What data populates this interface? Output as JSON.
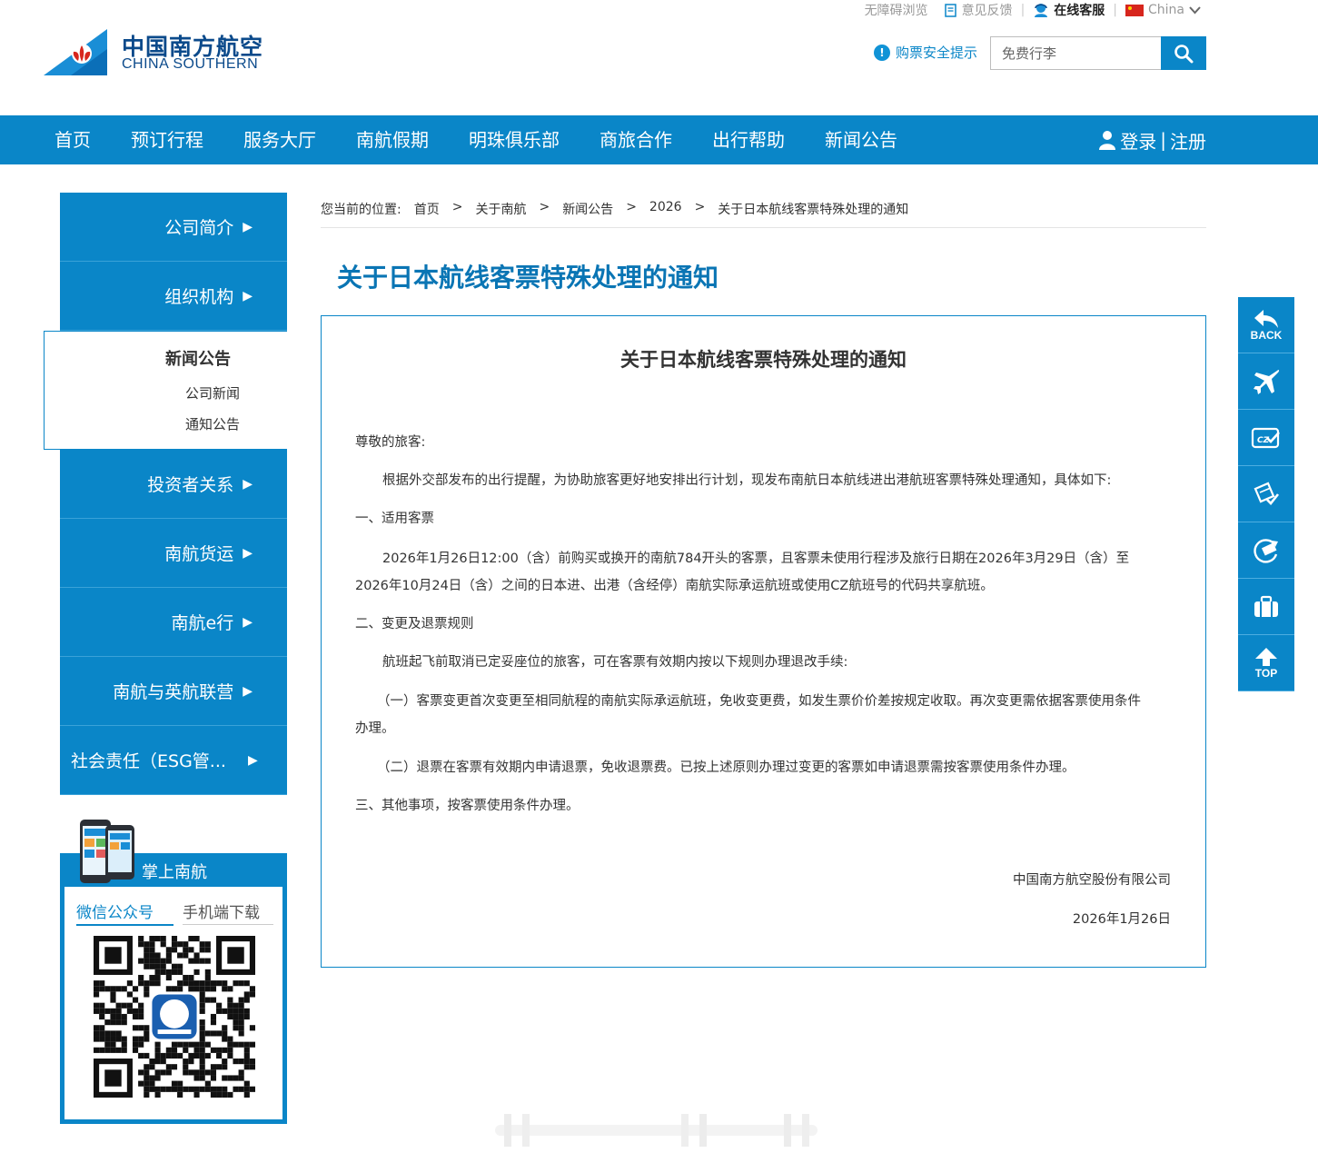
{
  "brand": {
    "name_cn": "中国南方航空",
    "name_en": "CHINA SOUTHERN",
    "accent_color": "#0a86c8",
    "title_color": "#0a75b4"
  },
  "top_links": {
    "accessibility": "无障碍浏览",
    "feedback": "意见反馈",
    "online_service": "在线客服",
    "region": "China"
  },
  "security_tip": "购票安全提示",
  "search": {
    "placeholder": "免费行李",
    "icon": "search-icon"
  },
  "nav": {
    "items": [
      "首页",
      "预订行程",
      "服务大厅",
      "南航假期",
      "明珠俱乐部",
      "商旅合作",
      "出行帮助",
      "新闻公告"
    ],
    "login": "登录",
    "divider": "|",
    "register": "注册"
  },
  "sidebar": {
    "items_before": [
      "公司简介",
      "组织机构"
    ],
    "active": {
      "title": "新闻公告",
      "subs": [
        "公司新闻",
        "通知公告"
      ]
    },
    "items_after": [
      "投资者关系",
      "南航货运",
      "南航e行",
      "南航与英航联营"
    ],
    "esg": "社会责任（ESG管...",
    "arrow": "▶"
  },
  "mobile": {
    "title": "掌上南航",
    "tabs": [
      "微信公众号",
      "手机端下载"
    ]
  },
  "breadcrumb": {
    "prefix": "您当前的位置:",
    "items": [
      "首页",
      "关于南航",
      "新闻公告",
      "2026",
      "关于日本航线客票特殊处理的通知"
    ],
    "separator": ">"
  },
  "page_title": "关于日本航线客票特殊处理的通知",
  "article": {
    "title": "关于日本航线客票特殊处理的通知",
    "greeting": "尊敬的旅客:",
    "intro": "根据外交部发布的出行提醒，为协助旅客更好地安排出行计划，现发布南航日本航线进出港航班客票特殊处理通知，具体如下:",
    "section1_title": "一、适用客票",
    "section1_body_line1": "2026年1月26日12:00（含）前购买或换开的南航784开头的客票，且客票未使用行程涉及旅行日期在2026年3月29日（含）至",
    "section1_body_line2": "2026年10月24日（含）之间的日本进、出港（含经停）南航实际承运航班或使用CZ航班号的代码共享航班。",
    "section2_title": "二、变更及退票规则",
    "section2_intro": "航班起飞前取消已定妥座位的旅客，可在客票有效期内按以下规则办理退改手续:",
    "rule1_line1": "（一）客票变更首次变更至相同航程的南航实际承运航班，免收变更费，如发生票价价差按规定收取。再次变更需依据客票使用条件",
    "rule1_line2": "办理。",
    "rule2": "（二）退票在客票有效期内申请退票，免收退票费。已按上述原则办理过变更的客票如申请退票需按客票使用条件办理。",
    "section3": "三、其他事项，按客票使用条件办理。",
    "signer": "中国南方航空股份有限公司",
    "date": "2026年1月26日"
  },
  "floatbar": {
    "back": "BACK",
    "top": "TOP",
    "icons": [
      "back-arrow-icon",
      "airplane-icon",
      "checkin-icon",
      "ticket-icon",
      "refund-icon",
      "baggage-icon",
      "up-arrow-icon"
    ]
  }
}
